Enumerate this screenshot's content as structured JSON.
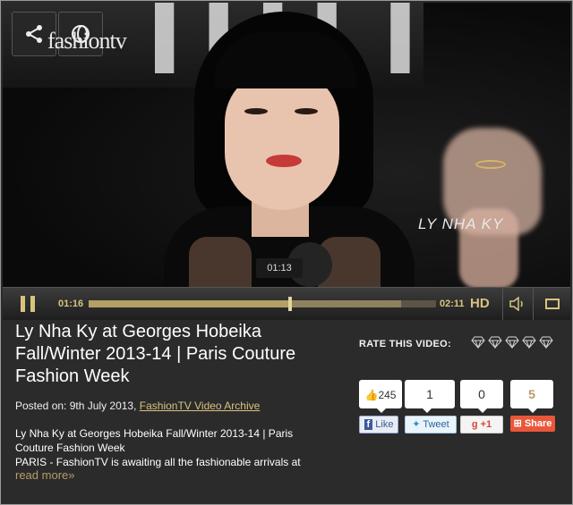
{
  "video": {
    "caption": "LY NHA KY",
    "logo_text": "fashiontv",
    "tooltip_time": "01:13",
    "current_time": "01:16",
    "total_time": "02:11",
    "quality_label": "HD",
    "progress": 0.58,
    "buffered": 0.9
  },
  "article": {
    "title": "Ly Nha Ky at Georges Hobeika Fall/Winter 2013-14 | Paris Couture Fashion Week",
    "posted_prefix": "Posted on: 9th July 2013, ",
    "posted_link": "FashionTV Video Archive",
    "description_line1": "Ly Nha Ky at Georges Hobeika Fall/Winter 2013-14 | Paris Couture Fashion Week",
    "description_line2": "PARIS - FashionTV is awaiting all the fashionable arrivals at",
    "read_more": "read more"
  },
  "rating": {
    "label": "RATE THIS VIDEO:",
    "stars_total": 5,
    "stars_filled": 0
  },
  "social": {
    "facebook": {
      "count": "245",
      "label": "Like",
      "color": "#3b5998"
    },
    "twitter": {
      "count": "1",
      "label": "Tweet",
      "color": "#2a90c8"
    },
    "google": {
      "count": "0",
      "label": "+1",
      "color": "#d34836"
    },
    "share": {
      "count": "5",
      "label": "Share",
      "color": "#e9573b"
    }
  },
  "colors": {
    "accent_gold": "#d8c37e",
    "panel_bg": "#2b2b2b"
  }
}
